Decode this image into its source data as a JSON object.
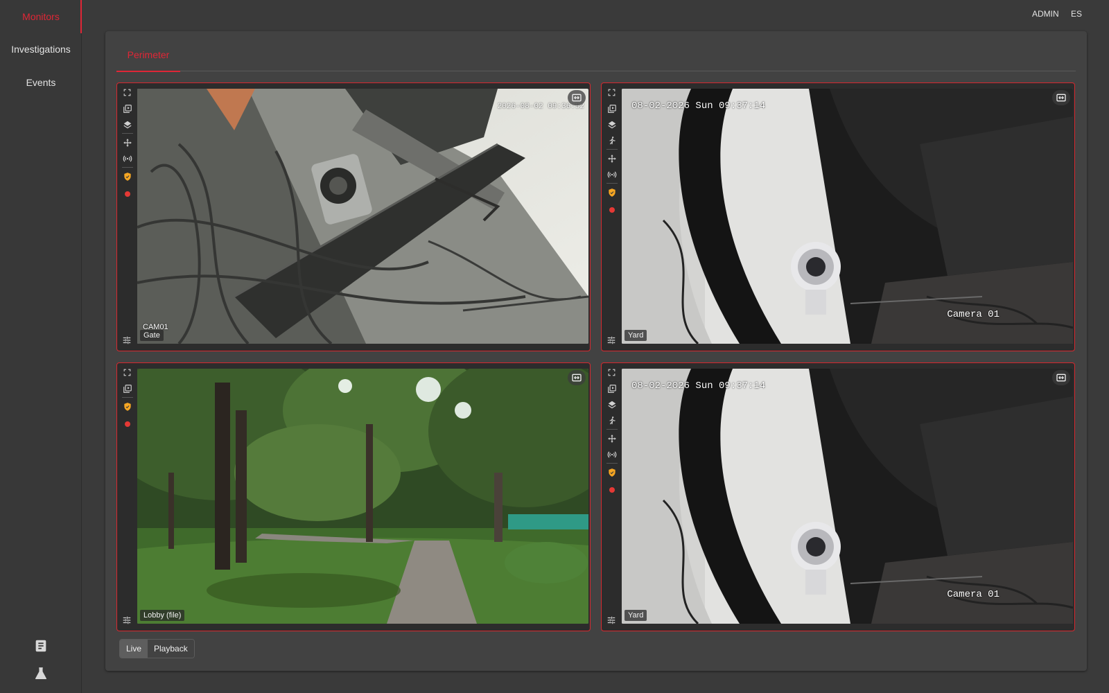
{
  "sidebar": {
    "items": [
      {
        "label": "Monitors",
        "active": true
      },
      {
        "label": "Investigations",
        "active": false
      },
      {
        "label": "Events",
        "active": false
      }
    ],
    "bottom_icons": [
      "document-icon",
      "flask-icon"
    ]
  },
  "header": {
    "user": "ADMIN",
    "language": "ES"
  },
  "tabs": [
    {
      "label": "Perimeter",
      "active": true
    }
  ],
  "colors": {
    "accent": "#e02636",
    "record": "#e53935",
    "shield": "#f5a623",
    "background": "#3a3a3a",
    "panel": "#424242"
  },
  "cameras": [
    {
      "name": "Gate",
      "overlay_text": "CAM01",
      "timestamp": "2026-08-02 09:36:52",
      "toolbar": [
        "fullscreen-icon",
        "snapshot-icon",
        "layers-icon",
        "ptz-move-icon",
        "signal-icon",
        "shield-icon",
        "record-icon"
      ]
    },
    {
      "name": "Yard",
      "overlay_text": "Camera 01",
      "timestamp": "08-02-2026 Sun 09:37:14",
      "toolbar": [
        "fullscreen-icon",
        "snapshot-icon",
        "layers-icon",
        "motion-icon",
        "ptz-move-icon",
        "signal-icon",
        "shield-icon",
        "record-icon"
      ]
    },
    {
      "name": "Lobby (file)",
      "overlay_text": "",
      "timestamp": "",
      "toolbar": [
        "fullscreen-icon",
        "snapshot-icon",
        "shield-icon",
        "record-icon"
      ]
    },
    {
      "name": "Yard",
      "overlay_text": "Camera 01",
      "timestamp": "08-02-2026 Sun 09:37:14",
      "toolbar": [
        "fullscreen-icon",
        "snapshot-icon",
        "layers-icon",
        "motion-icon",
        "ptz-move-icon",
        "signal-icon",
        "shield-icon",
        "record-icon"
      ]
    }
  ],
  "modes": [
    {
      "label": "Live",
      "active": true
    },
    {
      "label": "Playback",
      "active": false
    }
  ]
}
